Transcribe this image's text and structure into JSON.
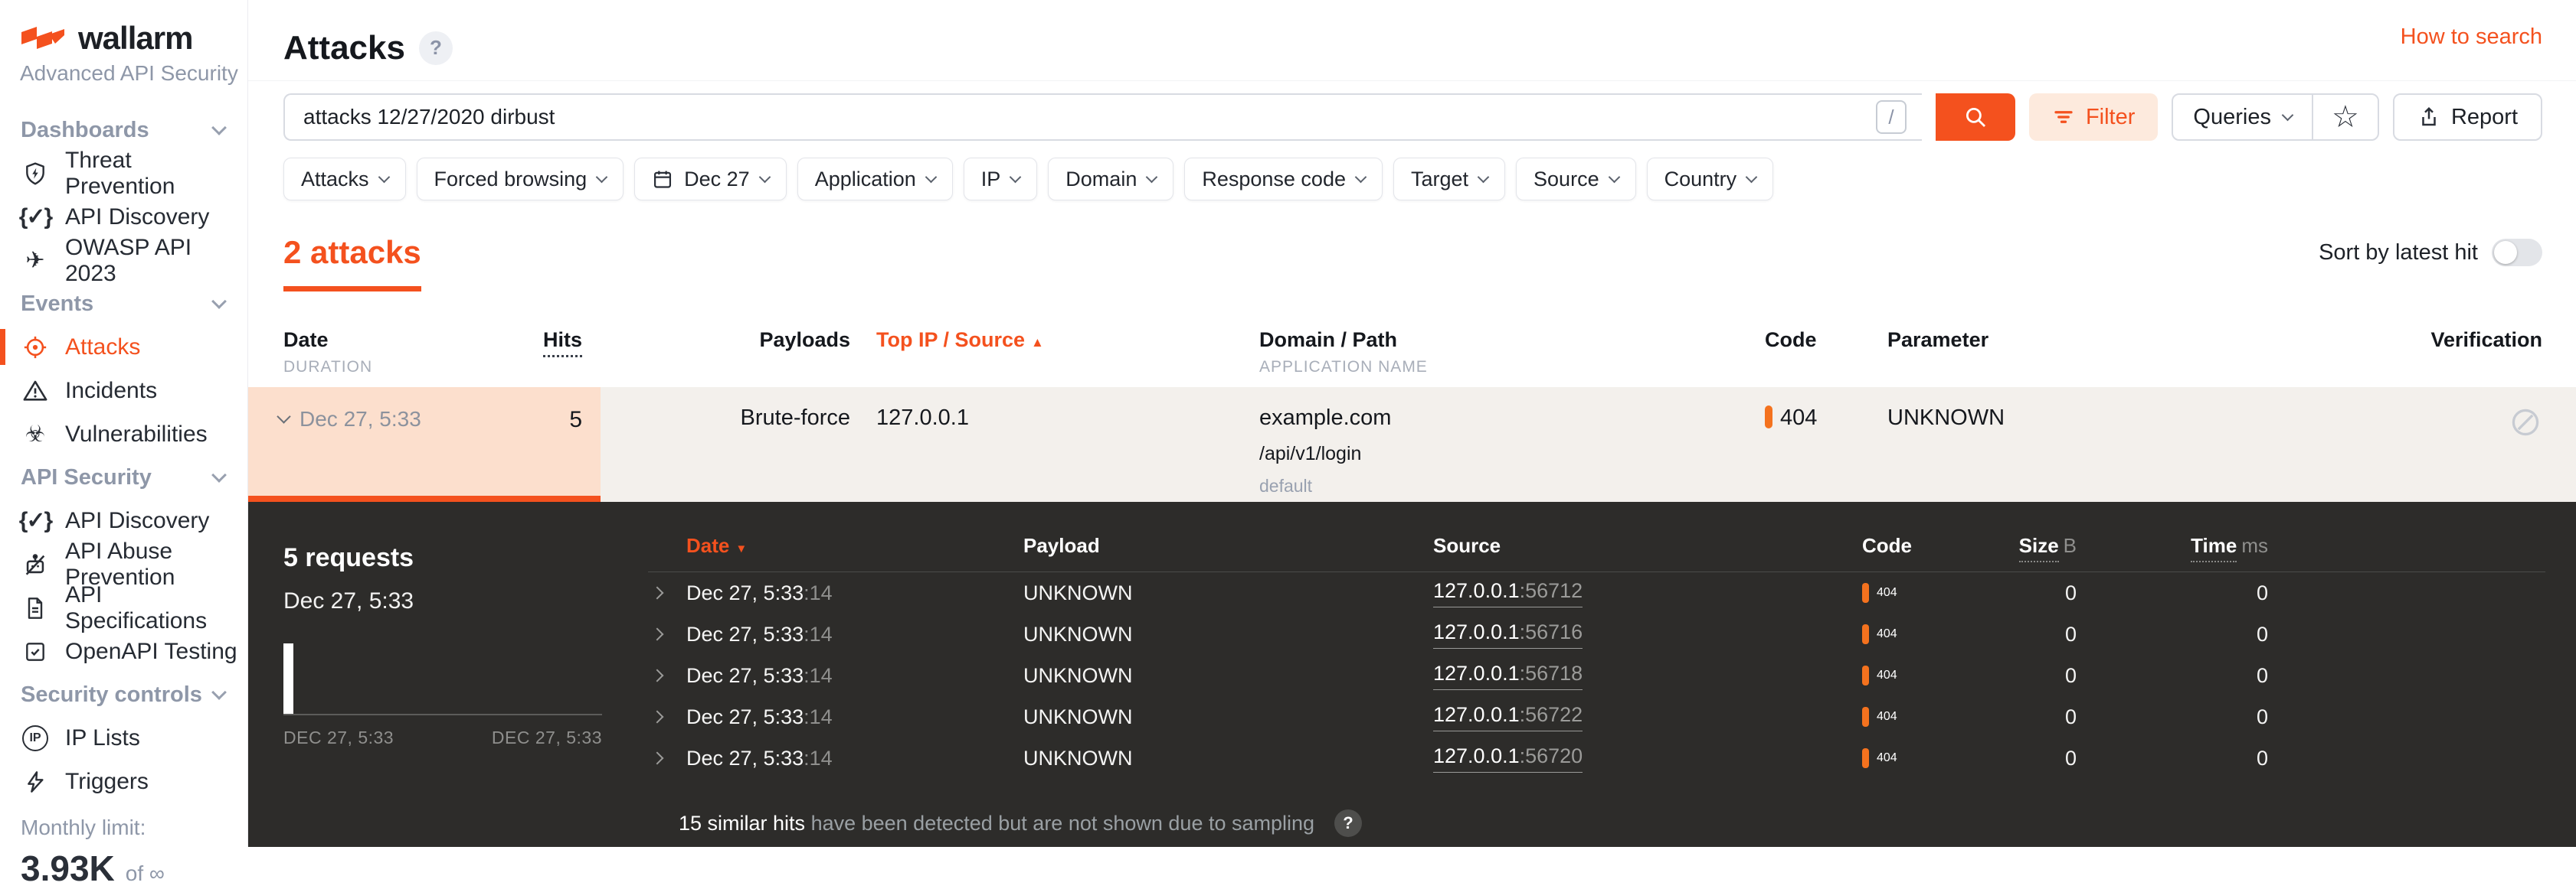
{
  "colors": {
    "accent": "#f4511e",
    "code_bar": "#f4721e",
    "dark_bg": "#2d2c2a",
    "row_bg": "#f3f0ec",
    "highlight_cell_bg": "#fcdfcd"
  },
  "icons": {
    "help": "?",
    "star": "☆",
    "biohazard": "☣",
    "paper_plane": "✈",
    "curly_check": "{✓}",
    "slash_key": "/",
    "sort_asc": "▲",
    "sort_desc": "▼",
    "question_badge": "?",
    "ip": "IP"
  },
  "sidebar": {
    "logo_text": "wallarm",
    "subtitle": "Advanced API Security",
    "sections": [
      {
        "label": "Dashboards",
        "items": [
          {
            "label": "Threat Prevention"
          },
          {
            "label": "API Discovery"
          },
          {
            "label": "OWASP API 2023"
          }
        ]
      },
      {
        "label": "Events",
        "items": [
          {
            "label": "Attacks",
            "active": true
          },
          {
            "label": "Incidents"
          },
          {
            "label": "Vulnerabilities"
          }
        ]
      },
      {
        "label": "API Security",
        "items": [
          {
            "label": "API Discovery"
          },
          {
            "label": "API Abuse Prevention"
          },
          {
            "label": "API Specifications"
          },
          {
            "label": "OpenAPI Testing"
          }
        ]
      },
      {
        "label": "Security controls",
        "items": [
          {
            "label": "IP Lists"
          },
          {
            "label": "Triggers"
          }
        ]
      }
    ],
    "monthly_limit_label": "Monthly limit:",
    "monthly_limit_value": "3.93K",
    "monthly_limit_suffix": "of ∞"
  },
  "header": {
    "title": "Attacks",
    "help_link": "How to search"
  },
  "search": {
    "query": "attacks 12/27/2020 dirbust",
    "shortcut": "/",
    "filter_label": "Filter",
    "queries_label": "Queries",
    "report_label": "Report"
  },
  "filter_chips": [
    {
      "label": "Attacks"
    },
    {
      "label": "Forced browsing"
    },
    {
      "label": "Dec 27",
      "icon": "calendar-icon"
    },
    {
      "label": "Application"
    },
    {
      "label": "IP"
    },
    {
      "label": "Domain"
    },
    {
      "label": "Response code"
    },
    {
      "label": "Target"
    },
    {
      "label": "Source"
    },
    {
      "label": "Country"
    }
  ],
  "results": {
    "count_label": "2 attacks",
    "sort_toggle_label": "Sort by latest hit",
    "sort_toggle_on": false
  },
  "attacks_table": {
    "columns": {
      "date": "Date",
      "date_sub": "DURATION",
      "hits": "Hits",
      "payloads": "Payloads",
      "top_ip": "Top IP / Source",
      "domain": "Domain / Path",
      "domain_sub": "APPLICATION NAME",
      "code": "Code",
      "parameter": "Parameter",
      "verification": "Verification"
    },
    "row": {
      "date": "Dec 27, 5:33",
      "hits": "5",
      "payloads": "Brute-force",
      "top_ip": "127.0.0.1",
      "domain": "example.com",
      "path": "/api/v1/login",
      "application": "default",
      "code": "404",
      "parameter": "UNKNOWN",
      "verification": "none"
    }
  },
  "details_panel": {
    "requests_title": "5 requests",
    "requests_date": "Dec 27, 5:33",
    "histogram": {
      "type": "bar",
      "x_start_label": "DEC 27, 5:33",
      "x_end_label": "DEC 27, 5:33",
      "bars": [
        {
          "x": "DEC 27, 5:33",
          "value": 5
        }
      ]
    },
    "columns": {
      "date": "Date",
      "payload": "Payload",
      "source": "Source",
      "code": "Code",
      "size": "Size",
      "size_unit": "B",
      "time": "Time",
      "time_unit": "ms"
    },
    "rows": [
      {
        "date": "Dec 27, 5:33",
        "seconds": ":14",
        "payload": "UNKNOWN",
        "ip": "127.0.0.1",
        "port": ":56712",
        "code": "404",
        "size": "0",
        "time": "0"
      },
      {
        "date": "Dec 27, 5:33",
        "seconds": ":14",
        "payload": "UNKNOWN",
        "ip": "127.0.0.1",
        "port": ":56716",
        "code": "404",
        "size": "0",
        "time": "0"
      },
      {
        "date": "Dec 27, 5:33",
        "seconds": ":14",
        "payload": "UNKNOWN",
        "ip": "127.0.0.1",
        "port": ":56718",
        "code": "404",
        "size": "0",
        "time": "0"
      },
      {
        "date": "Dec 27, 5:33",
        "seconds": ":14",
        "payload": "UNKNOWN",
        "ip": "127.0.0.1",
        "port": ":56722",
        "code": "404",
        "size": "0",
        "time": "0"
      },
      {
        "date": "Dec 27, 5:33",
        "seconds": ":14",
        "payload": "UNKNOWN",
        "ip": "127.0.0.1",
        "port": ":56720",
        "code": "404",
        "size": "0",
        "time": "0"
      }
    ],
    "sampling_note_strong": "15 similar hits",
    "sampling_note_rest": "have been detected but are not shown due to sampling"
  }
}
